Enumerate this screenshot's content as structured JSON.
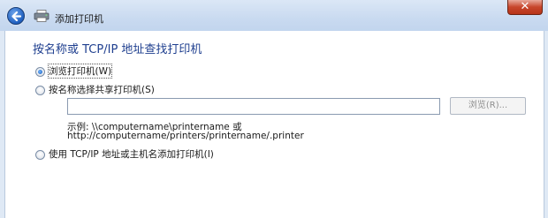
{
  "window": {
    "title": "添加打印机",
    "close_symbol": "✕"
  },
  "main": {
    "heading": "按名称或 TCP/IP 地址查找打印机",
    "options": [
      {
        "label": "浏览打印机(W)",
        "selected": true
      },
      {
        "label": "按名称选择共享打印机(S)",
        "selected": false
      },
      {
        "label": "使用 TCP/IP 地址或主机名添加打印机(I)",
        "selected": false
      }
    ],
    "share_input": {
      "value": "",
      "placeholder": ""
    },
    "browse_label": "浏览(R)...",
    "example_line1": "示例: \\\\computername\\printername 或",
    "example_line2": "http://computername/printers/printername/.printer"
  },
  "colors": {
    "heading": "#1f3f8f",
    "close_button": "#c7462b",
    "background": "#dfe9f5"
  },
  "icons": [
    "back-arrow-icon",
    "printer-icon",
    "close-icon"
  ]
}
